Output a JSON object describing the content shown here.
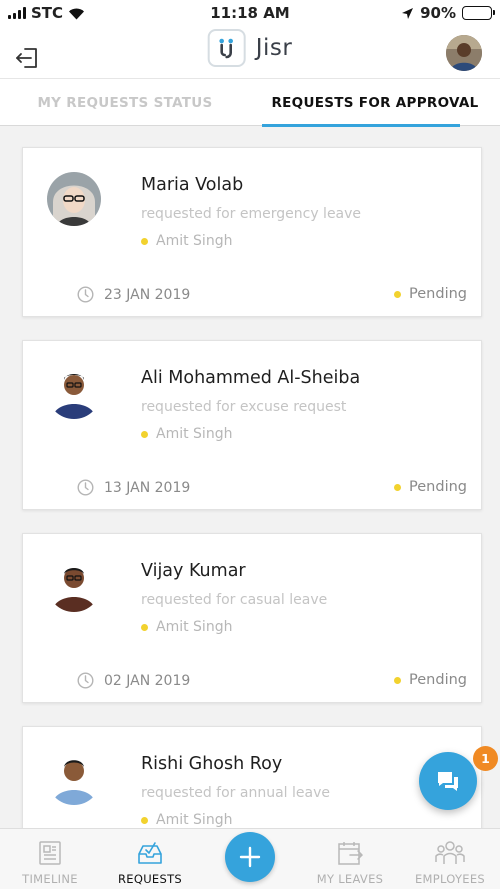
{
  "status_bar": {
    "carrier": "STC",
    "time": "11:18 AM",
    "battery": "90%",
    "battery_level": 0.9
  },
  "header": {
    "app_name": "Jisr"
  },
  "tabs": [
    {
      "label": "MY REQUESTS STATUS",
      "active": false
    },
    {
      "label": "REQUESTS FOR APPROVAL",
      "active": true
    }
  ],
  "requests": [
    {
      "name": "Maria Volab",
      "description": "requested for emergency leave",
      "approver": "Amit Singh",
      "date": "23 JAN 2019",
      "status": "Pending"
    },
    {
      "name": "Ali Mohammed Al-Sheiba",
      "description": "requested for excuse request",
      "approver": "Amit Singh",
      "date": "13 JAN 2019",
      "status": "Pending"
    },
    {
      "name": "Vijay Kumar",
      "description": "requested for casual leave",
      "approver": "Amit Singh",
      "date": "02 JAN 2019",
      "status": "Pending"
    },
    {
      "name": "Rishi Ghosh Roy",
      "description": "requested for annual leave",
      "approver": "Amit Singh",
      "date": "",
      "status": ""
    }
  ],
  "chat": {
    "badge_count": "1"
  },
  "bottom_nav": [
    {
      "label": "TIMELINE",
      "icon": "timeline-icon",
      "active": false
    },
    {
      "label": "REQUESTS",
      "icon": "requests-icon",
      "active": true
    },
    {
      "label": "MY LEAVES",
      "icon": "calendar-icon",
      "active": false
    },
    {
      "label": "EMPLOYEES",
      "icon": "people-icon",
      "active": false
    }
  ],
  "colors": {
    "accent": "#35a3dc",
    "pending_dot": "#f2d22e",
    "badge": "#f08a24"
  }
}
